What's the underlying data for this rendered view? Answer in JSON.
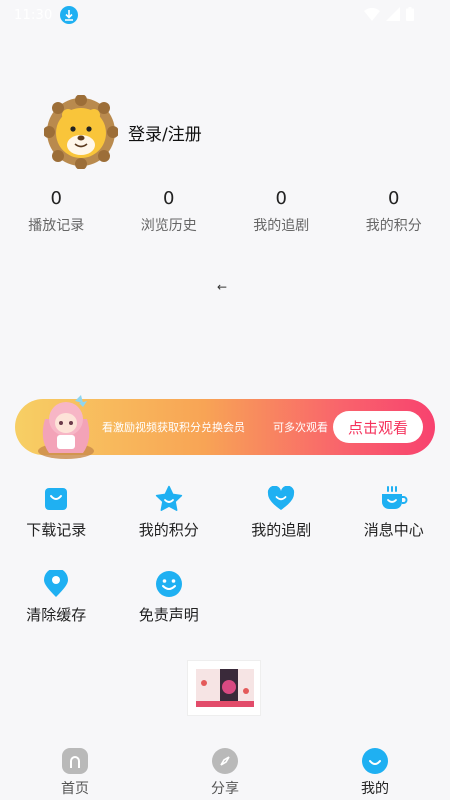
{
  "status_bar": {
    "time": "11:30"
  },
  "profile": {
    "login_label": "登录/注册"
  },
  "stats": [
    {
      "value": "0",
      "label": "播放记录"
    },
    {
      "value": "0",
      "label": "浏览历史"
    },
    {
      "value": "0",
      "label": "我的追剧"
    },
    {
      "value": "0",
      "label": "我的积分"
    }
  ],
  "arrow": "←",
  "banner": {
    "text": "看激励视频获取积分兑换会员",
    "text2": "可多次观看",
    "button": "点击观看"
  },
  "grid_row1": [
    {
      "label": "下载记录",
      "icon": "bag-icon"
    },
    {
      "label": "我的积分",
      "icon": "star-icon"
    },
    {
      "label": "我的追剧",
      "icon": "heart-icon"
    },
    {
      "label": "消息中心",
      "icon": "cup-icon"
    }
  ],
  "grid_row2": [
    {
      "label": "清除缓存",
      "icon": "location-icon"
    },
    {
      "label": "免责声明",
      "icon": "smile-icon"
    }
  ],
  "nav": [
    {
      "label": "首页",
      "icon": "home-icon",
      "active": false
    },
    {
      "label": "分享",
      "icon": "compass-icon",
      "active": false
    },
    {
      "label": "我的",
      "icon": "smile-icon",
      "active": true
    }
  ],
  "colors": {
    "accent": "#1fb0f2",
    "banner_button_text": "#f5325c",
    "inactive_nav": "#b9b9b9"
  }
}
